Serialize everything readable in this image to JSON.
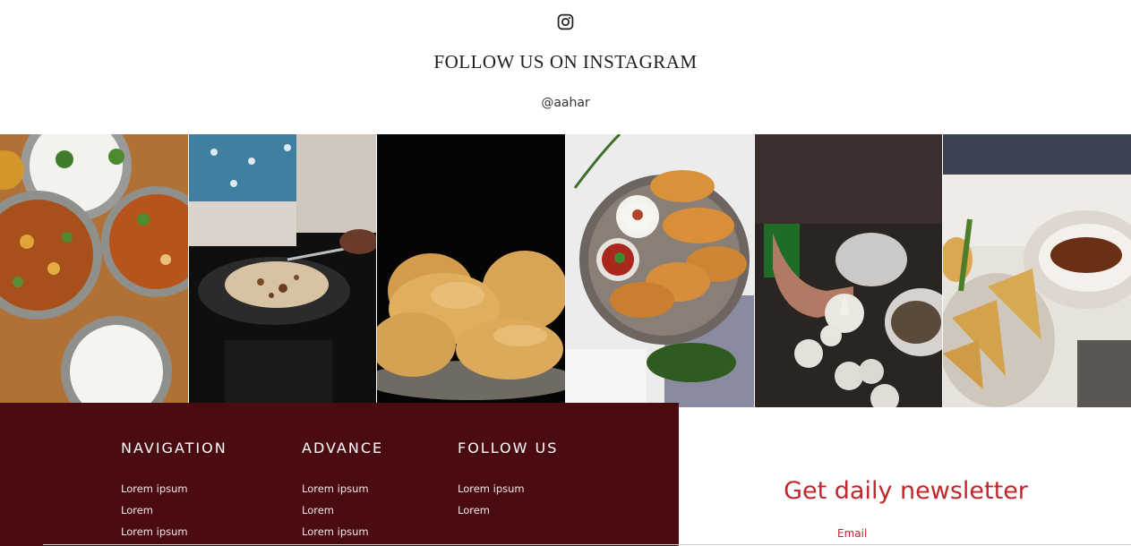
{
  "instagram": {
    "icon": "instagram-icon",
    "title": "FOLLOW US ON INSTAGRAM",
    "handle": "@aahar"
  },
  "gallery": {
    "photos": [
      {
        "subject": "curry-bowls-with-rice"
      },
      {
        "subject": "roti-on-griddle"
      },
      {
        "subject": "puri"
      },
      {
        "subject": "gujiya-platter-with-chutneys"
      },
      {
        "subject": "hand-holding-modak"
      },
      {
        "subject": "samosa-with-fritters"
      }
    ]
  },
  "footer": {
    "background": "#4a0c10",
    "columns": [
      {
        "heading": "NAVIGATION",
        "links": [
          "Lorem ipsum",
          "Lorem",
          "Lorem ipsum"
        ]
      },
      {
        "heading": "ADVANCE",
        "links": [
          "Lorem ipsum",
          "Lorem",
          "Lorem ipsum"
        ]
      },
      {
        "heading": "FOLLOW US",
        "links": [
          "Lorem ipsum",
          "Lorem"
        ]
      }
    ]
  },
  "newsletter": {
    "title": "Get daily newsletter",
    "email_label": "Email",
    "accent": "#c0262b"
  }
}
